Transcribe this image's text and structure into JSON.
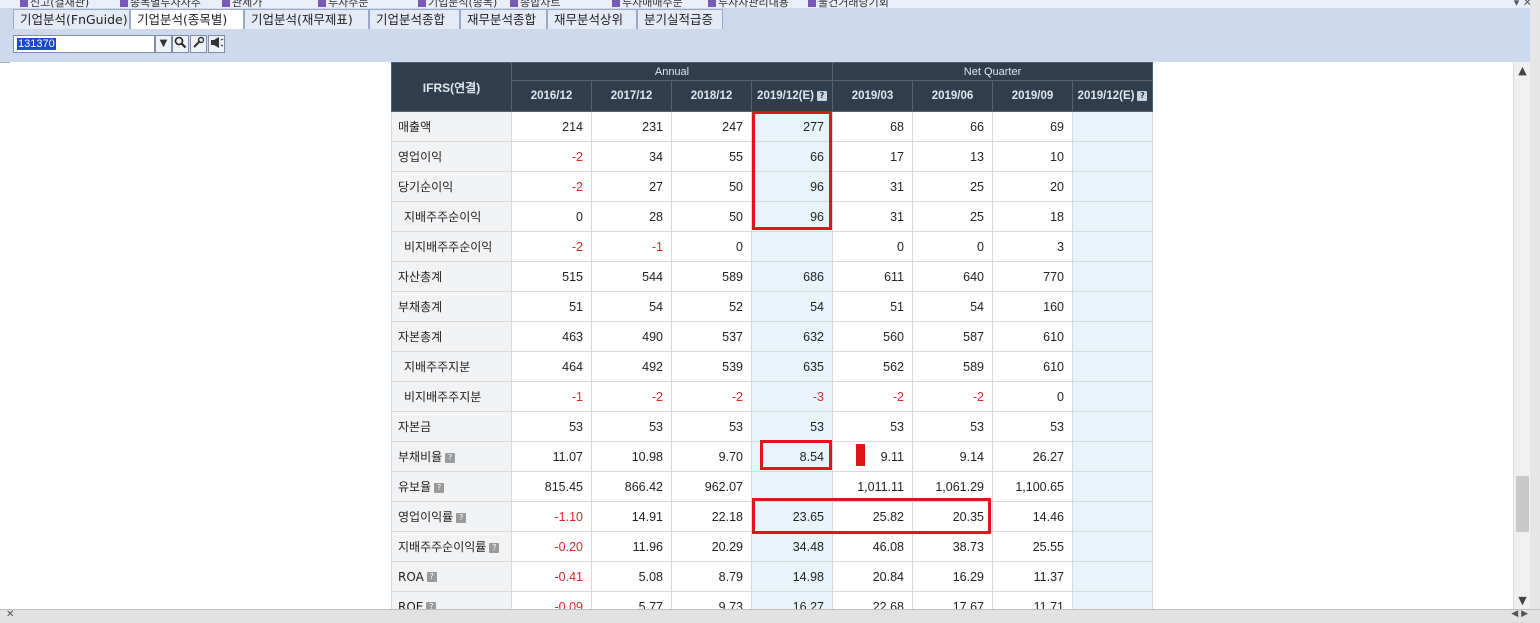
{
  "top_tabs": [
    "신고(결재관)",
    "종목별투자자추",
    "관세가",
    "투자주문",
    "기업분석(종목)",
    "종합차트",
    "투자매매주문",
    "투자자관리내용",
    "물건거래당기회"
  ],
  "tabs": [
    {
      "label": "기업분석(FnGuide)",
      "active": false
    },
    {
      "label": "기업분석(종목별)",
      "active": true
    },
    {
      "label": "기업분석(재무제표)",
      "active": false
    },
    {
      "label": "기업분석종합",
      "active": false
    },
    {
      "label": "재무분석종합",
      "active": false
    },
    {
      "label": "재무분석상위",
      "active": false
    },
    {
      "label": "분기실적급증",
      "active": false
    }
  ],
  "toolbar": {
    "stock_code": "131370",
    "dropdown_icon": "chevron-down-icon",
    "search_icon": "search-icon",
    "settings_icon": "wrench-icon",
    "speaker_icon": "speaker-icon"
  },
  "table": {
    "corner_label": "IFRS(연결)",
    "group_annual": "Annual",
    "group_quarter": "Net Quarter",
    "periods": [
      "2016/12",
      "2017/12",
      "2018/12",
      "2019/12(E)",
      "2019/03",
      "2019/06",
      "2019/09",
      "2019/12(E)"
    ],
    "estimate_columns": [
      3,
      7
    ],
    "rows": [
      {
        "label": "매출액",
        "indent": false,
        "help": false,
        "values": [
          "214",
          "231",
          "247",
          "277",
          "68",
          "66",
          "69",
          ""
        ]
      },
      {
        "label": "영업이익",
        "indent": false,
        "help": false,
        "values": [
          "-2",
          "34",
          "55",
          "66",
          "17",
          "13",
          "10",
          ""
        ]
      },
      {
        "label": "당기순이익",
        "indent": false,
        "help": false,
        "values": [
          "-2",
          "27",
          "50",
          "96",
          "31",
          "25",
          "20",
          ""
        ]
      },
      {
        "label": "지배주주순이익",
        "indent": true,
        "help": false,
        "values": [
          "0",
          "28",
          "50",
          "96",
          "31",
          "25",
          "18",
          ""
        ]
      },
      {
        "label": "비지배주주순이익",
        "indent": true,
        "help": false,
        "values": [
          "-2",
          "-1",
          "0",
          "",
          "0",
          "0",
          "3",
          ""
        ]
      },
      {
        "label": "자산총계",
        "indent": false,
        "help": false,
        "values": [
          "515",
          "544",
          "589",
          "686",
          "611",
          "640",
          "770",
          ""
        ]
      },
      {
        "label": "부채총계",
        "indent": false,
        "help": false,
        "values": [
          "51",
          "54",
          "52",
          "54",
          "51",
          "54",
          "160",
          ""
        ]
      },
      {
        "label": "자본총계",
        "indent": false,
        "help": false,
        "values": [
          "463",
          "490",
          "537",
          "632",
          "560",
          "587",
          "610",
          ""
        ]
      },
      {
        "label": "지배주주지분",
        "indent": true,
        "help": false,
        "values": [
          "464",
          "492",
          "539",
          "635",
          "562",
          "589",
          "610",
          ""
        ]
      },
      {
        "label": "비지배주주지분",
        "indent": true,
        "help": false,
        "values": [
          "-1",
          "-2",
          "-2",
          "-3",
          "-2",
          "-2",
          "0",
          ""
        ]
      },
      {
        "label": "자본금",
        "indent": false,
        "help": false,
        "values": [
          "53",
          "53",
          "53",
          "53",
          "53",
          "53",
          "53",
          ""
        ]
      },
      {
        "label": "부채비율",
        "indent": false,
        "help": true,
        "values": [
          "11.07",
          "10.98",
          "9.70",
          "8.54",
          "9.11",
          "9.14",
          "26.27",
          ""
        ]
      },
      {
        "label": "유보율",
        "indent": false,
        "help": true,
        "values": [
          "815.45",
          "866.42",
          "962.07",
          "",
          "1,011.11",
          "1,061.29",
          "1,100.65",
          ""
        ]
      },
      {
        "label": "영업이익률",
        "indent": false,
        "help": true,
        "values": [
          "-1.10",
          "14.91",
          "22.18",
          "23.65",
          "25.82",
          "20.35",
          "14.46",
          ""
        ]
      },
      {
        "label": "지배주주순이익률",
        "indent": false,
        "help": true,
        "values": [
          "-0.20",
          "11.96",
          "20.29",
          "34.48",
          "46.08",
          "38.73",
          "25.55",
          ""
        ]
      },
      {
        "label": "ROA",
        "indent": false,
        "help": true,
        "values": [
          "-0.41",
          "5.08",
          "8.79",
          "14.98",
          "20.84",
          "16.29",
          "11.37",
          ""
        ]
      },
      {
        "label": "ROE",
        "indent": false,
        "help": true,
        "values": [
          "-0.09",
          "5.77",
          "9.73",
          "16.27",
          "22.68",
          "17.67",
          "11.71",
          ""
        ]
      }
    ]
  },
  "colors": {
    "header_bg": "#2f3d4d",
    "estimate_bg": "#e8f4fa",
    "negative_text": "#d42a2a",
    "highlight_box": "#e0151b",
    "toolbar_bg": "#cfd9ee"
  }
}
